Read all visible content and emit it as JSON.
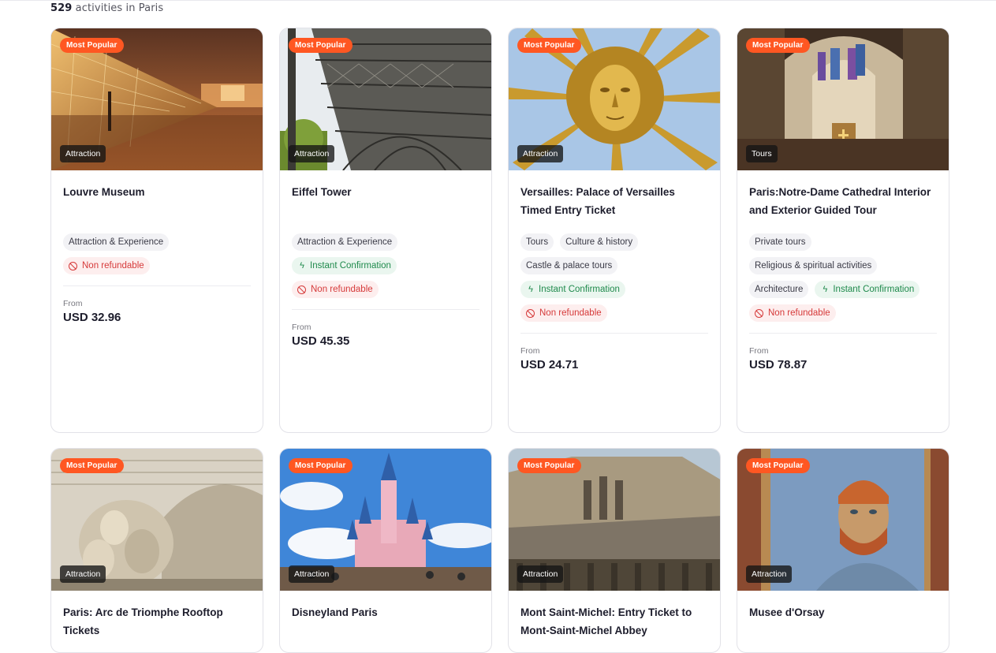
{
  "header": {
    "count": "529",
    "count_suffix": "activities in Paris"
  },
  "row1": [
    {
      "popular": "Most Popular",
      "category": "Attraction",
      "title": "Louvre Museum",
      "tags": [
        {
          "label": "Attraction & Experience",
          "kind": "plain"
        },
        {
          "label": "Non refundable",
          "kind": "red"
        }
      ],
      "from_label": "From",
      "price": "USD 32.96"
    },
    {
      "popular": "Most Popular",
      "category": "Attraction",
      "title": "Eiffel Tower",
      "tags": [
        {
          "label": "Attraction & Experience",
          "kind": "plain"
        },
        {
          "label": "Instant Confirmation",
          "kind": "green"
        },
        {
          "label": "Non refundable",
          "kind": "red"
        }
      ],
      "from_label": "From",
      "price": "USD 45.35"
    },
    {
      "popular": "Most Popular",
      "category": "Attraction",
      "title": "Versailles: Palace of Versailles Timed Entry Ticket",
      "tags": [
        {
          "label": "Tours",
          "kind": "plain"
        },
        {
          "label": "Culture & history",
          "kind": "plain"
        },
        {
          "label": "Castle & palace tours",
          "kind": "plain"
        },
        {
          "label": "Instant Confirmation",
          "kind": "green"
        },
        {
          "label": "Non refundable",
          "kind": "red"
        }
      ],
      "from_label": "From",
      "price": "USD 24.71"
    },
    {
      "popular": "Most Popular",
      "category": "Tours",
      "title": "Paris:Notre-Dame Cathedral Interior and Exterior Guided Tour",
      "tags": [
        {
          "label": "Private tours",
          "kind": "plain"
        },
        {
          "label": "Religious & spiritual activities",
          "kind": "plain"
        },
        {
          "label": "Architecture",
          "kind": "plain"
        },
        {
          "label": "Instant Confirmation",
          "kind": "green"
        },
        {
          "label": "Non refundable",
          "kind": "red"
        }
      ],
      "from_label": "From",
      "price": "USD 78.87"
    }
  ],
  "row2": [
    {
      "popular": "Most Popular",
      "category": "Attraction",
      "title": "Paris: Arc de Triomphe Rooftop Tickets"
    },
    {
      "popular": "Most Popular",
      "category": "Attraction",
      "title": "Disneyland Paris"
    },
    {
      "popular": "Most Popular",
      "category": "Attraction",
      "title": "Mont Saint-Michel: Entry Ticket to Mont-Saint-Michel Abbey"
    },
    {
      "popular": "Most Popular",
      "category": "Attraction",
      "title": "Musee d'Orsay"
    }
  ],
  "icons": {
    "instant": "lightning-icon",
    "nonrefund": "no-entry-icon"
  },
  "colors": {
    "accent": "#ff5722",
    "green": "#1f8a4c",
    "red": "#d63a3a"
  }
}
